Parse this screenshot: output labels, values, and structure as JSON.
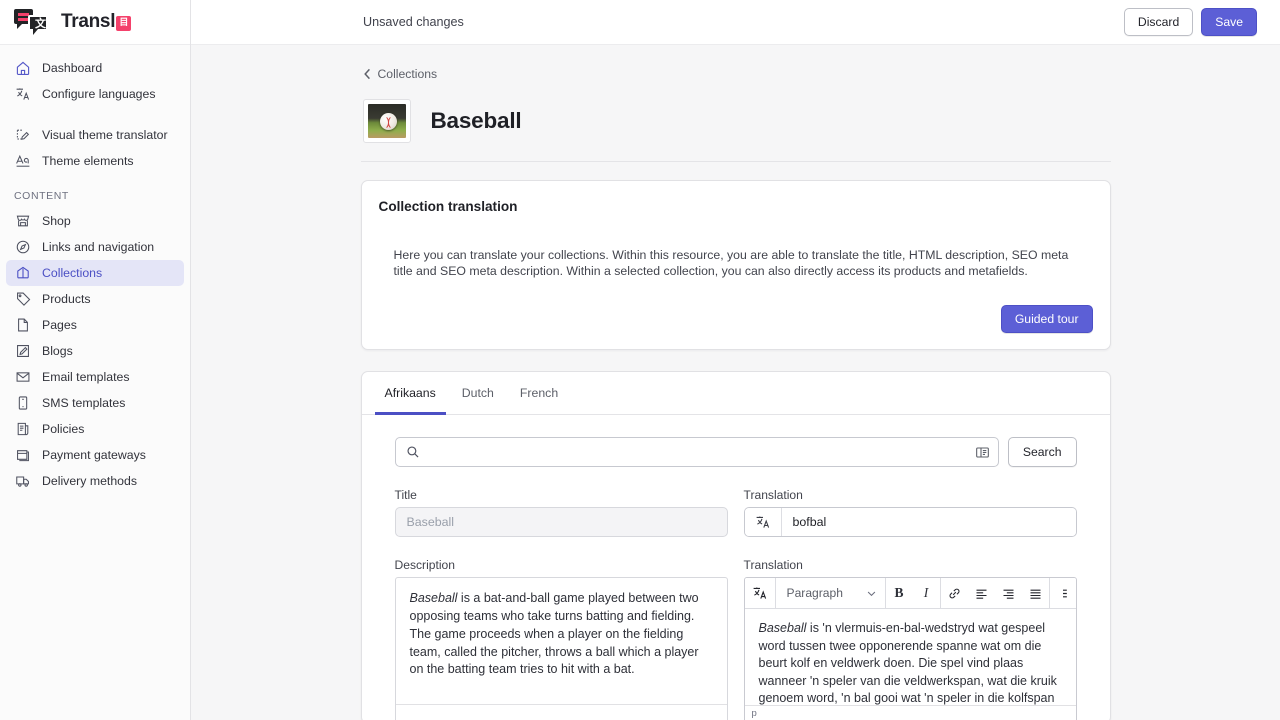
{
  "brand": {
    "name": "Transl",
    "badge_glyph": "目",
    "accent": "#f4416b",
    "indigo": "#5c5fd6"
  },
  "sidebar": {
    "primary": [
      {
        "label": "Dashboard",
        "icon": "home-icon"
      },
      {
        "label": "Configure languages",
        "icon": "translate-icon"
      }
    ],
    "theme": [
      {
        "label": "Visual theme translator",
        "icon": "theme-edit-icon"
      },
      {
        "label": "Theme elements",
        "icon": "typography-icon"
      }
    ],
    "section_label": "CONTENT",
    "content": [
      {
        "label": "Shop",
        "icon": "store-icon",
        "active": false
      },
      {
        "label": "Links and navigation",
        "icon": "compass-icon",
        "active": false
      },
      {
        "label": "Collections",
        "icon": "collection-icon",
        "active": true
      },
      {
        "label": "Products",
        "icon": "tag-icon",
        "active": false
      },
      {
        "label": "Pages",
        "icon": "page-icon",
        "active": false
      },
      {
        "label": "Blogs",
        "icon": "pencil-square-icon",
        "active": false
      },
      {
        "label": "Email templates",
        "icon": "envelope-icon",
        "active": false
      },
      {
        "label": "SMS templates",
        "icon": "phone-icon",
        "active": false
      },
      {
        "label": "Policies",
        "icon": "scroll-icon",
        "active": false
      },
      {
        "label": "Payment gateways",
        "icon": "card-icon",
        "active": false
      },
      {
        "label": "Delivery methods",
        "icon": "truck-icon",
        "active": false
      }
    ]
  },
  "topbar": {
    "status": "Unsaved changes",
    "discard_label": "Discard",
    "save_label": "Save"
  },
  "breadcrumb": {
    "label": "Collections"
  },
  "header": {
    "title": "Baseball",
    "thumbnail": "baseball-thumbnail"
  },
  "intro_card": {
    "title": "Collection translation",
    "body": "Here you can translate your collections. Within this resource, you are able to translate the title, HTML description, SEO meta title and SEO meta description. Within a selected collection, you can also directly access its products and metafields.",
    "cta_label": "Guided tour"
  },
  "tabs": [
    {
      "label": "Afrikaans",
      "active": true
    },
    {
      "label": "Dutch",
      "active": false
    },
    {
      "label": "French",
      "active": false
    }
  ],
  "search": {
    "value": "",
    "placeholder": "",
    "button_label": "Search",
    "left_icon": "search-icon",
    "right_icon": "filter-panel-icon"
  },
  "fields": {
    "title": {
      "label": "Title",
      "value": "Baseball",
      "readonly": true
    },
    "title_translation": {
      "label": "Translation",
      "value": "bofbal",
      "icon": "translate-icon"
    },
    "description": {
      "label": "Description",
      "emphasis": "Baseball",
      "body": " is a bat-and-ball game played between two opposing teams who take turns batting and fielding. The game proceeds when a player on the fielding team, called the pitcher, throws a ball which a player on the batting team tries to hit with a bat."
    },
    "description_translation": {
      "label": "Translation",
      "emphasis": "Baseball",
      "body": " is 'n vlermuis-en-bal-wedstryd wat gespeel word tussen twee opponerende spanne wat om die beurt kolf en veldwerk doen. Die spel vind plaas wanneer 'n speler van die veldwerkspan, wat die kruik genoem word, 'n bal gooi wat 'n speler in die kolfspan",
      "status_path": "p",
      "toolbar": {
        "translate_icon": "translate-icon",
        "block_format": "Paragraph",
        "chevron_icon": "chevron-down-icon",
        "bold_label": "B",
        "italic_label": "I",
        "link_icon": "link-icon",
        "align_left_icon": "align-left-icon",
        "align_right_icon": "align-right-icon",
        "align_justify_icon": "align-justify-icon",
        "more_icon": "grid-more-icon"
      }
    }
  }
}
